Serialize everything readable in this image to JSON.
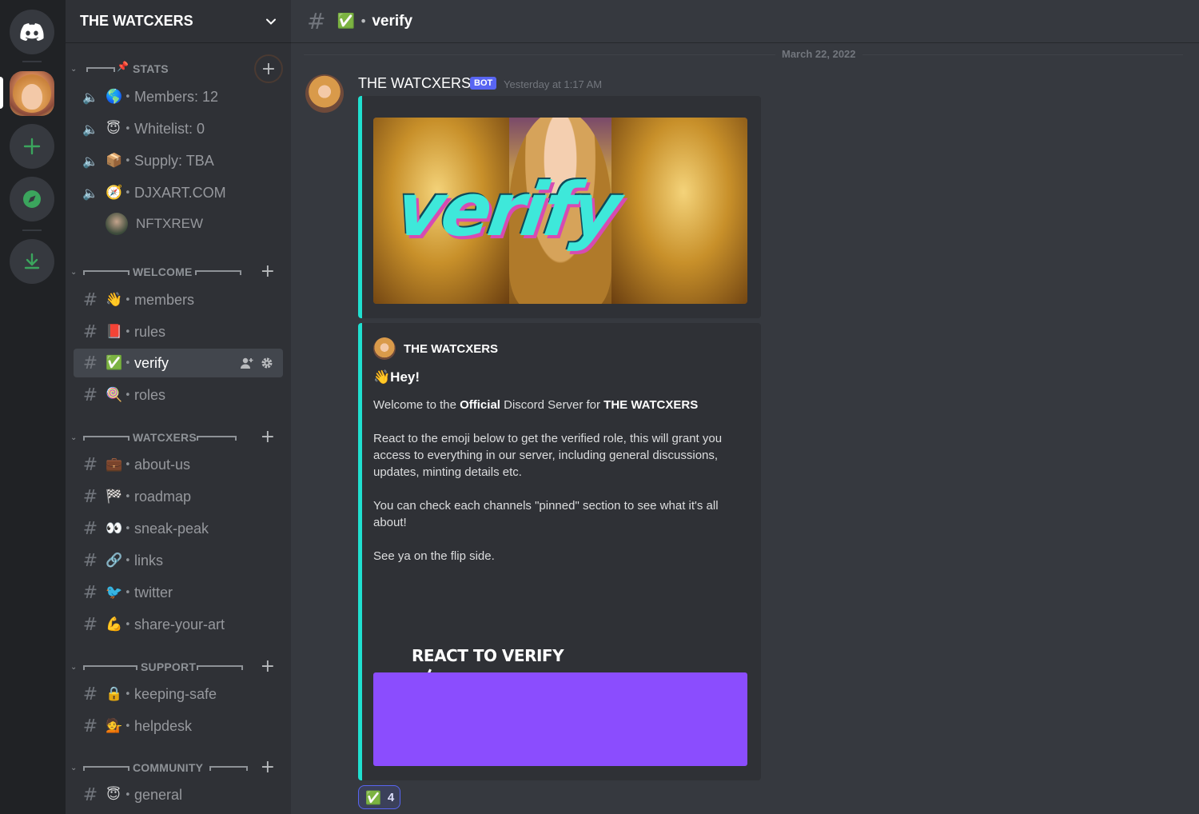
{
  "server": {
    "name": "THE WATCXERS"
  },
  "channel": {
    "hash": "#",
    "emoji": "✅",
    "name": "verify"
  },
  "categories": {
    "stats": "STATS",
    "welcome": "WELCOME",
    "watcxers": "WATCXERS",
    "support": "SUPPORT",
    "community": "COMMUNITY"
  },
  "stats_channels": [
    {
      "emoji": "🌎",
      "name": "Members: 12"
    },
    {
      "emoji": "😇",
      "name": "Whitelist: 0"
    },
    {
      "emoji": "📦",
      "name": "Supply: TBA"
    },
    {
      "emoji": "🧭",
      "name": "DJXART.COM"
    }
  ],
  "voice_user": "NFTXREW",
  "welcome_channels": [
    {
      "emoji": "👋",
      "name": "members"
    },
    {
      "emoji": "📕",
      "name": "rules"
    },
    {
      "emoji": "✅",
      "name": "verify"
    },
    {
      "emoji": "🍭",
      "name": "roles"
    }
  ],
  "watcxers_channels": [
    {
      "emoji": "💼",
      "name": "about-us"
    },
    {
      "emoji": "🏁",
      "name": "roadmap"
    },
    {
      "emoji": "👀",
      "name": "sneak-peak"
    },
    {
      "emoji": "🔗",
      "name": "links"
    },
    {
      "emoji": "🐦",
      "name": "twitter"
    },
    {
      "emoji": "💪",
      "name": "share-your-art"
    }
  ],
  "support_channels": [
    {
      "emoji": "🔒",
      "name": "keeping-safe"
    },
    {
      "emoji": "💁",
      "name": "helpdesk"
    }
  ],
  "community_channels": [
    {
      "emoji": "😇",
      "name": "general"
    }
  ],
  "date_divider": "March 22, 2022",
  "message": {
    "author": "THE WATCXERS",
    "badge": "BOT",
    "timestamp": "Yesterday at 1:17 AM",
    "banner_text": "verify",
    "embed_author": "THE WATCXERS",
    "embed_title_emoji": "👋",
    "embed_title": "Hey!",
    "line1_a": "Welcome to the ",
    "line1_b": "Official",
    "line1_c": " Discord Server for ",
    "line1_d": "THE WATCXERS",
    "para2": "React to the emoji below to get the verified role, this will grant you access to everything in our server, including general discussions, updates, minting details etc.",
    "para3": "You can check each channels \"pinned\" section to see what it's all about!",
    "para4": "See ya on the flip side.",
    "gif_label": "REACT TO VERIFY"
  },
  "reaction": {
    "emoji": "✅",
    "count": "4"
  },
  "colors": {
    "accent": "#1fe0d0",
    "blurple": "#5865f2",
    "purple": "#8b4dfe"
  }
}
